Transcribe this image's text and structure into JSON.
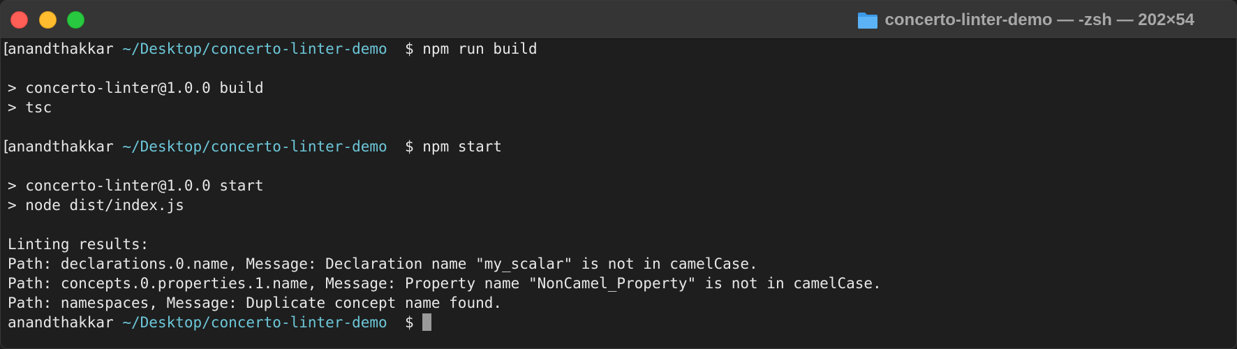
{
  "window": {
    "title": "concerto-linter-demo — -zsh — 202×54"
  },
  "terminal": {
    "user": "anandthakkar",
    "path": "~/Desktop/concerto-linter-demo",
    "prompt_char": "$",
    "commands": {
      "build": "npm run build",
      "start": "npm start"
    },
    "build_output": [
      "> concerto-linter@1.0.0 build",
      "> tsc"
    ],
    "start_output": [
      "> concerto-linter@1.0.0 start",
      "> node dist/index.js"
    ],
    "results_header": "Linting results:",
    "results": [
      "Path: declarations.0.name, Message: Declaration name \"my_scalar\" is not in camelCase.",
      "Path: concepts.0.properties.1.name, Message: Property name \"NonCamel_Property\" is not in camelCase.",
      "Path: namespaces, Message: Duplicate concept name found."
    ]
  },
  "colors": {
    "background": "#1e1e1e",
    "titlebar": "#353535",
    "path_cyan": "#6cc7d9",
    "text": "#e8e8e8",
    "close": "#ff5f57",
    "minimize": "#febc2e",
    "zoom": "#28c840"
  },
  "icons": {
    "title": "folder-icon",
    "window_controls": [
      "close-button",
      "minimize-button",
      "zoom-button"
    ]
  }
}
